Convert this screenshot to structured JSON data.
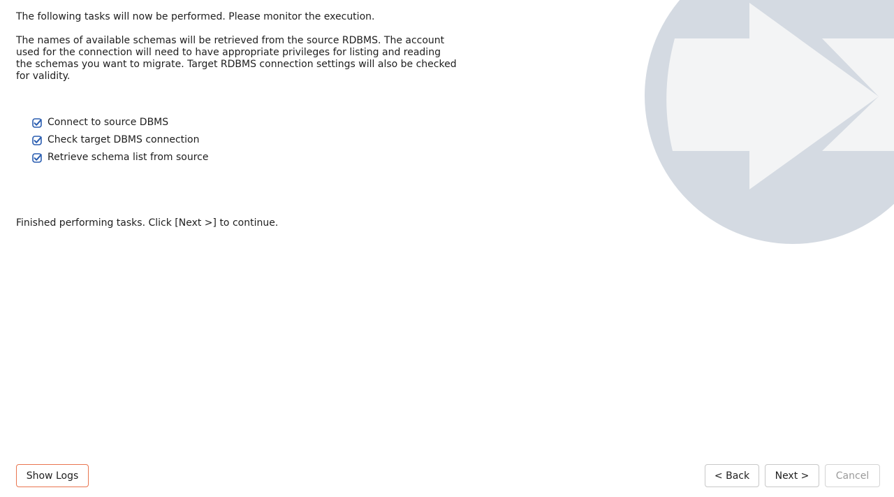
{
  "intro_text": "The following tasks will now be performed. Please monitor the execution.",
  "description": "The names of available schemas will be retrieved from the source RDBMS. The account used for the connection will need to have appropriate privileges for listing and reading the schemas you want to migrate. Target RDBMS connection settings will also be checked for validity.",
  "tasks": [
    {
      "label": "Connect to source DBMS",
      "status": "done",
      "icon": "checkbox-checked-icon"
    },
    {
      "label": "Check target DBMS connection",
      "status": "done",
      "icon": "checkbox-checked-icon"
    },
    {
      "label": "Retrieve schema list from source",
      "status": "done",
      "icon": "checkbox-checked-icon"
    }
  ],
  "status_message": "Finished performing tasks. Click [Next >] to continue.",
  "buttons": {
    "show_logs": "Show Logs",
    "back": "< Back",
    "next": "Next >",
    "cancel": "Cancel"
  },
  "colors": {
    "check_accent": "#2a5db0",
    "logs_button_border": "#e9754f",
    "graphic_circle": "#d4dae2",
    "graphic_arrow": "#f3f4f5",
    "disabled_text": "#9a9a9a"
  }
}
